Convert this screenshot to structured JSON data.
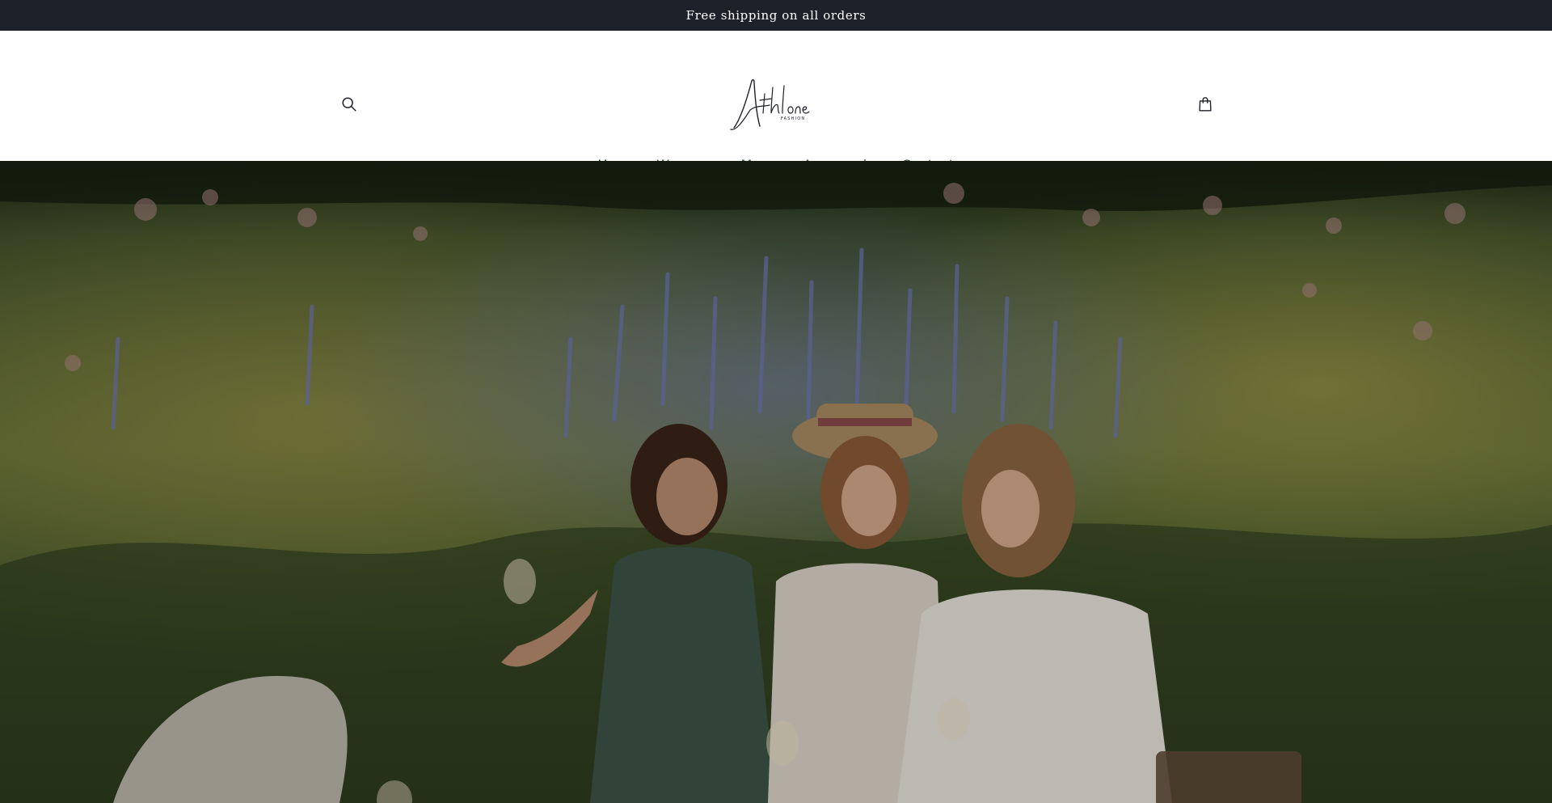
{
  "announcement": {
    "text": "Free shipping on all orders"
  },
  "header": {
    "search_icon": "search-icon",
    "cart_icon": "cart-bag-icon",
    "logo": {
      "brand": "Athlone",
      "subtitle": "FASHION"
    }
  },
  "nav": {
    "items": [
      {
        "label": "Home",
        "active": true,
        "has_dropdown": false
      },
      {
        "label": "Women",
        "active": false,
        "has_dropdown": true
      },
      {
        "label": "Men",
        "active": false,
        "has_dropdown": true
      },
      {
        "label": "Accessories",
        "active": false,
        "has_dropdown": false
      },
      {
        "label": "Contact",
        "active": false,
        "has_dropdown": false
      }
    ]
  },
  "colors": {
    "announcement_bg": "#1e202a",
    "text_primary": "#1e202a",
    "nav_text": "#4b4c53"
  }
}
